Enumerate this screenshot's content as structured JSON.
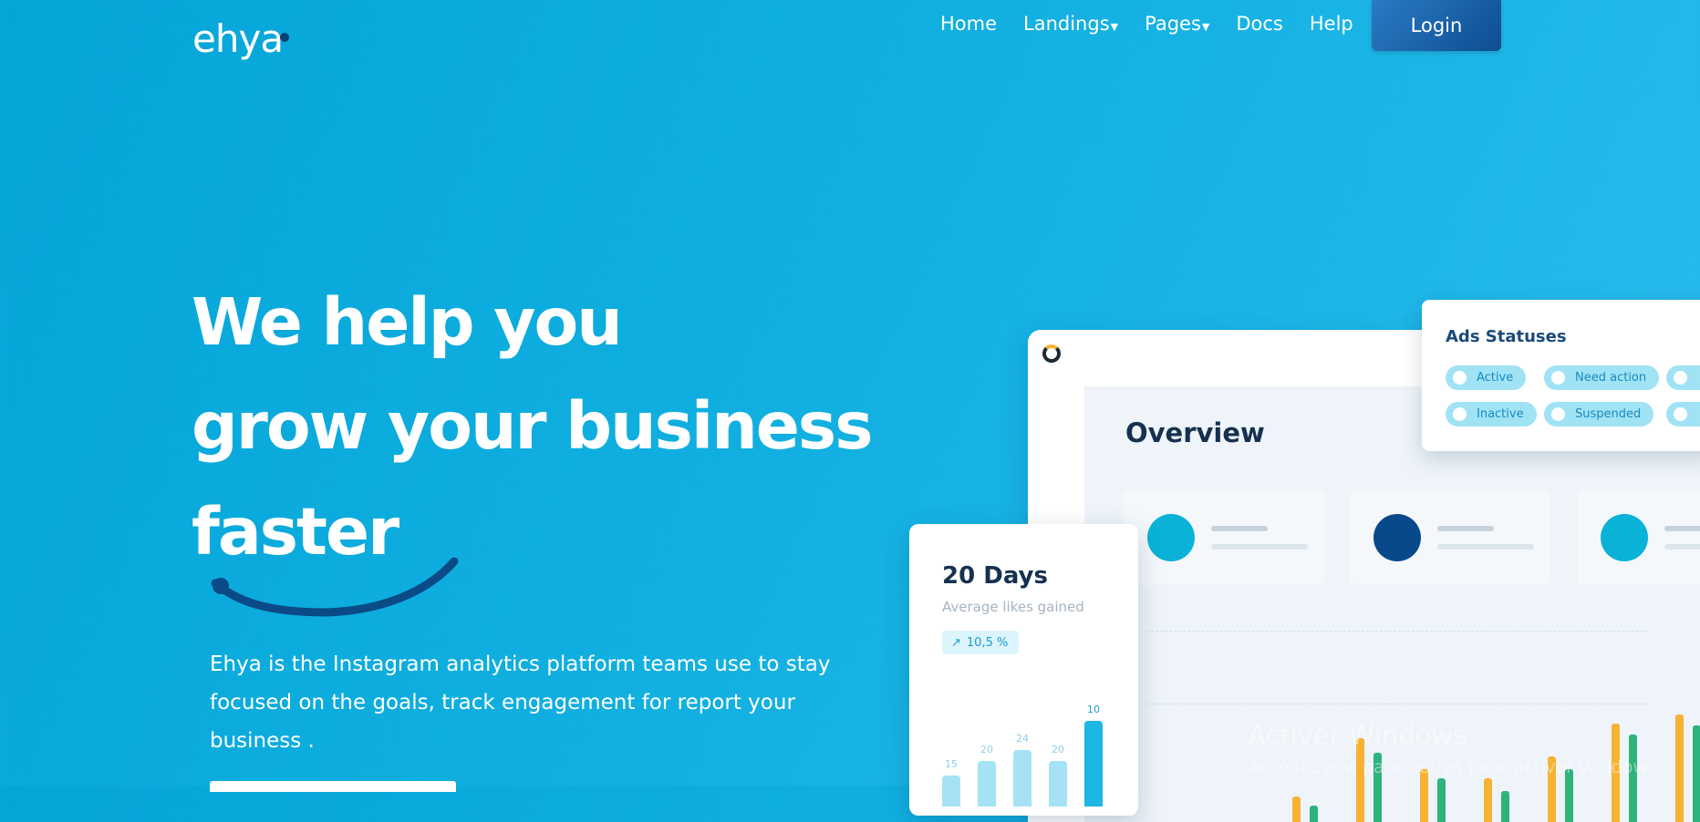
{
  "header": {
    "logo": "ehya",
    "nav": [
      "Home",
      "Landings",
      "Pages",
      "Docs",
      "Help"
    ],
    "nav_dropdown_icon": "chevron-down-icon",
    "login_label": "Login"
  },
  "hero": {
    "title_lines": [
      "We help you",
      "grow your business",
      "faster"
    ],
    "description": "Ehya is the Instagram analytics platform teams use to stay focused on the goals, track engagement for report your business ."
  },
  "dashboard": {
    "overview_title": "Overview",
    "stat_colors": [
      "#0ab2d8",
      "#08498a",
      "#0ab2d8"
    ]
  },
  "ads_card": {
    "title": "Ads Statuses",
    "statuses": [
      "Active",
      "Need action",
      "Inactive",
      "Suspended"
    ]
  },
  "days_card": {
    "title": "20 Days",
    "subtitle": "Average likes gained",
    "badge": "10,5 %",
    "bar_values": [
      15,
      20,
      24,
      20,
      10
    ]
  },
  "watermark": {
    "line1": "Activer Windows",
    "line2": "Accédez aux paramètres pour activer Windows."
  },
  "colors": {
    "background": "#10afe0",
    "login_button": "#0d4d91",
    "accent_yellow": "#f7b233",
    "accent_green": "#2db37c"
  }
}
